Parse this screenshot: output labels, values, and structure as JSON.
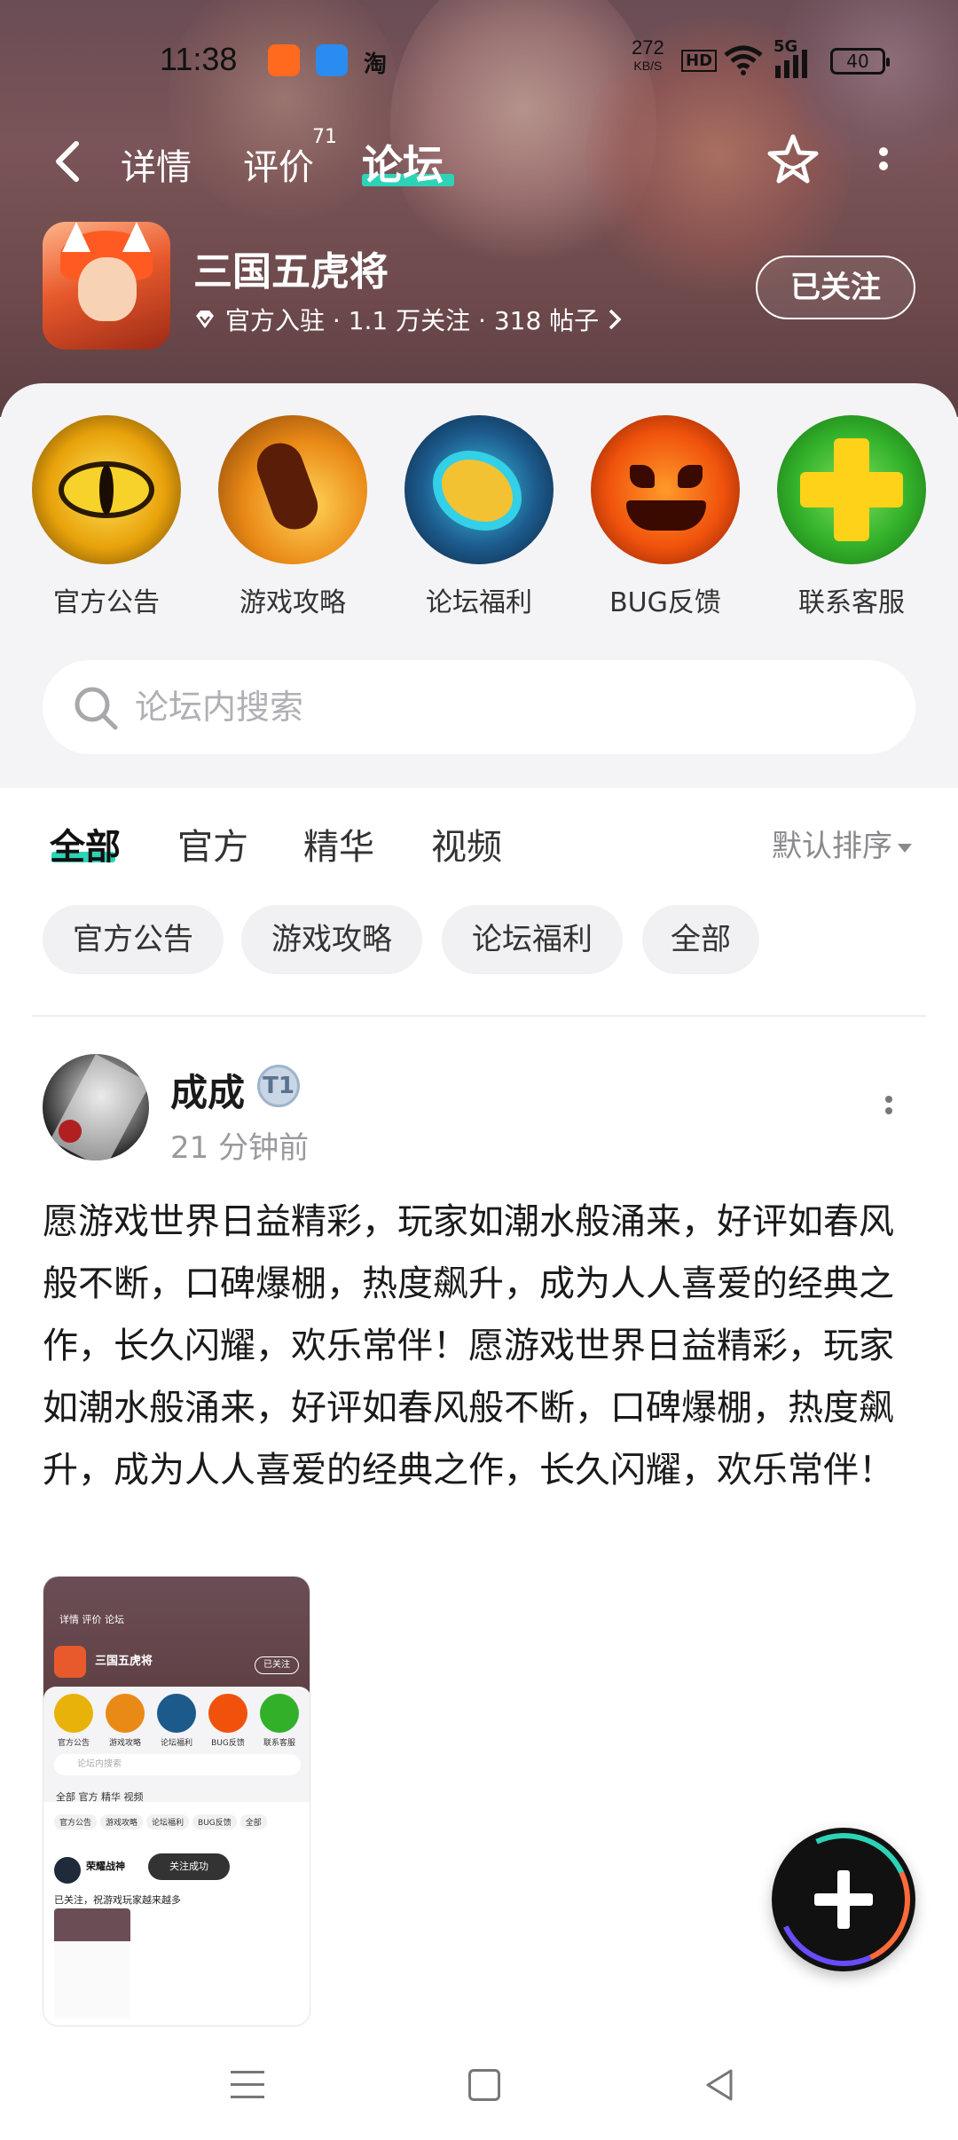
{
  "status_bar": {
    "time": "11:38",
    "net_rate": "272",
    "net_unit": "KB/S",
    "hd": "HD",
    "signal_label": "5G",
    "battery": "40",
    "app_icon_3": "淘"
  },
  "nav": {
    "tabs": [
      {
        "label": "详情"
      },
      {
        "label": "评价",
        "count": "71"
      },
      {
        "label": "论坛"
      }
    ],
    "active_tab": "论坛",
    "accent_color": "#2ed3b7"
  },
  "game": {
    "title": "三国五虎将",
    "meta": "官方入驻 · 1.1 万关注 · 318 帖子",
    "follow_label": "已关注"
  },
  "categories": [
    {
      "label": "官方公告",
      "icon": "eye-icon"
    },
    {
      "label": "游戏攻略",
      "icon": "fist-icon"
    },
    {
      "label": "论坛福利",
      "icon": "wave-icon"
    },
    {
      "label": "BUG反馈",
      "icon": "pumpkin-icon"
    },
    {
      "label": "联系客服",
      "icon": "plus-cross-icon"
    }
  ],
  "search": {
    "placeholder": "论坛内搜索"
  },
  "filter_tabs": [
    {
      "label": "全部"
    },
    {
      "label": "官方"
    },
    {
      "label": "精华"
    },
    {
      "label": "视频"
    }
  ],
  "sort_label": "默认排序",
  "chips": [
    "官方公告",
    "游戏攻略",
    "论坛福利",
    "全部"
  ],
  "post": {
    "author": "成成",
    "badge": "T1",
    "time": "21 分钟前",
    "body": "愿游戏世界日益精彩，玩家如潮水般涌来，好评如春风般不断，口碑爆棚，热度飙升，成为人人喜爱的经典之作，长久闪耀，欢乐常伴！愿游戏世界日益精彩，玩家如潮水般涌来，好评如春风般不断，口碑爆棚，热度飙升，成为人人喜爱的经典之作，长久闪耀，欢乐常伴！",
    "thumbnail": {
      "tabs": "详情   评价   论坛",
      "title": "三国五虎将",
      "follow": "已关注",
      "labels": [
        "官方公告",
        "游戏攻略",
        "论坛福利",
        "BUG反馈",
        "联系客服"
      ],
      "search": "论坛内搜索",
      "ftabs": "全部   官方   精华   视频",
      "chips": [
        "官方公告",
        "游戏攻略",
        "论坛福利",
        "BUG反馈",
        "全部"
      ],
      "user": "荣耀战神",
      "toast": "关注成功",
      "text": "已关注，祝游戏玩家越来越多"
    }
  },
  "fab_label": "+"
}
